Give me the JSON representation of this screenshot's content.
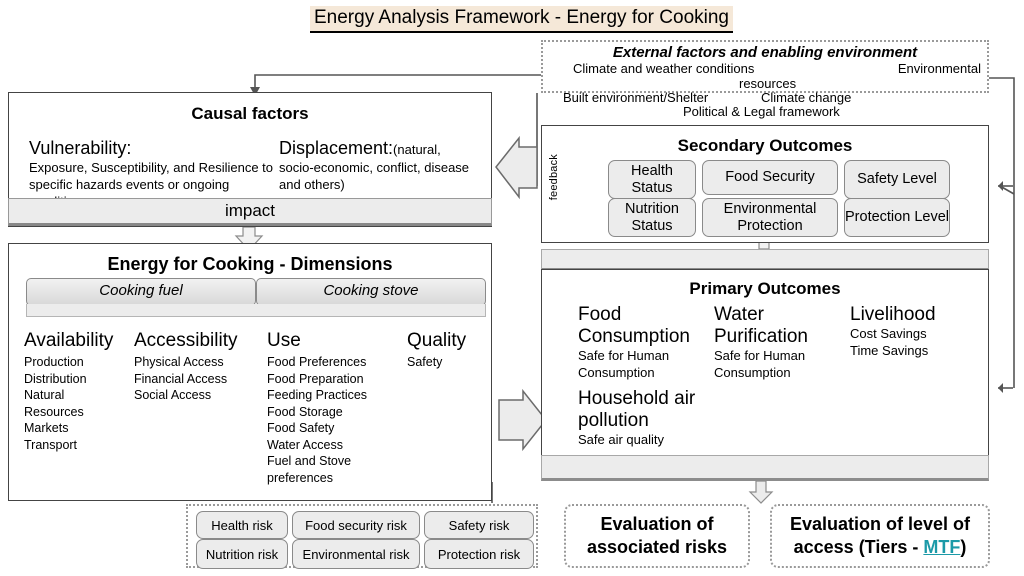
{
  "title": "Energy Analysis Framework - Energy for Cooking",
  "external": {
    "heading": "External factors and enabling environment",
    "items": {
      "climate": "Climate and weather conditions",
      "environmental": "Environmental",
      "resources": "resources",
      "built": "Built environment/Shelter",
      "climate_change": "Climate change",
      "political": "Political & Legal framework"
    }
  },
  "causal": {
    "title": "Causal factors",
    "vulnerability": {
      "head": "Vulnerability:",
      "body": "Exposure, Susceptibility, and Resilience to specific hazards events or ongoing conditions"
    },
    "displacement": {
      "head": "Displacement:",
      "paren": "(natural,",
      "body": "socio-economic, conflict, disease and others)"
    },
    "impact": "impact"
  },
  "dimensions": {
    "title": "Energy for Cooking - Dimensions",
    "tabs": {
      "fuel": "Cooking fuel",
      "stove": "Cooking stove"
    },
    "columns": [
      {
        "head": "Availability",
        "items": [
          "Production",
          "Distribution",
          "Natural",
          "Resources",
          "Markets",
          "Transport"
        ]
      },
      {
        "head": "Accessibility",
        "items": [
          "Physical Access",
          "Financial Access",
          "Social Access"
        ]
      },
      {
        "head": "Use",
        "items": [
          "Food Preferences",
          "Food Preparation",
          "Feeding Practices",
          "Food Storage",
          "Food Safety",
          "Water Access",
          "Fuel and Stove",
          "preferences"
        ]
      },
      {
        "head": "Quality",
        "items": [
          "Safety"
        ]
      }
    ]
  },
  "secondary": {
    "title": "Secondary Outcomes",
    "feedback_label": "feedback",
    "pills": {
      "health": "Health Status",
      "food_security": "Food Security",
      "safety": "Safety Level",
      "nutrition": "Nutrition Status",
      "environmental": "Environmental Protection",
      "protection": "Protection Level"
    }
  },
  "primary": {
    "title": "Primary Outcomes",
    "columns": [
      {
        "head": "Food Consumption",
        "body": "Safe for Human Consumption"
      },
      {
        "head": "Water Purification",
        "body": "Safe for Human Consumption"
      },
      {
        "head": "Livelihood",
        "body": "Cost Savings\nTime Savings"
      },
      {
        "head": "Household air pollution",
        "body": "Safe air quality"
      }
    ]
  },
  "risks": {
    "health": "Health risk",
    "food_security": "Food security risk",
    "safety": "Safety risk",
    "nutrition": "Nutrition risk",
    "environmental": "Environmental risk",
    "protection": "Protection risk"
  },
  "evaluation": {
    "risks_label": "Evaluation of associated risks",
    "access_prefix": "Evaluation of level of access (Tiers - ",
    "access_link": "MTF",
    "access_suffix": ")"
  },
  "colors": {
    "title_highlight": "#f5e8d8",
    "pill_fill": "#ececec",
    "link": "#1c9aa8",
    "line": "#555555"
  }
}
